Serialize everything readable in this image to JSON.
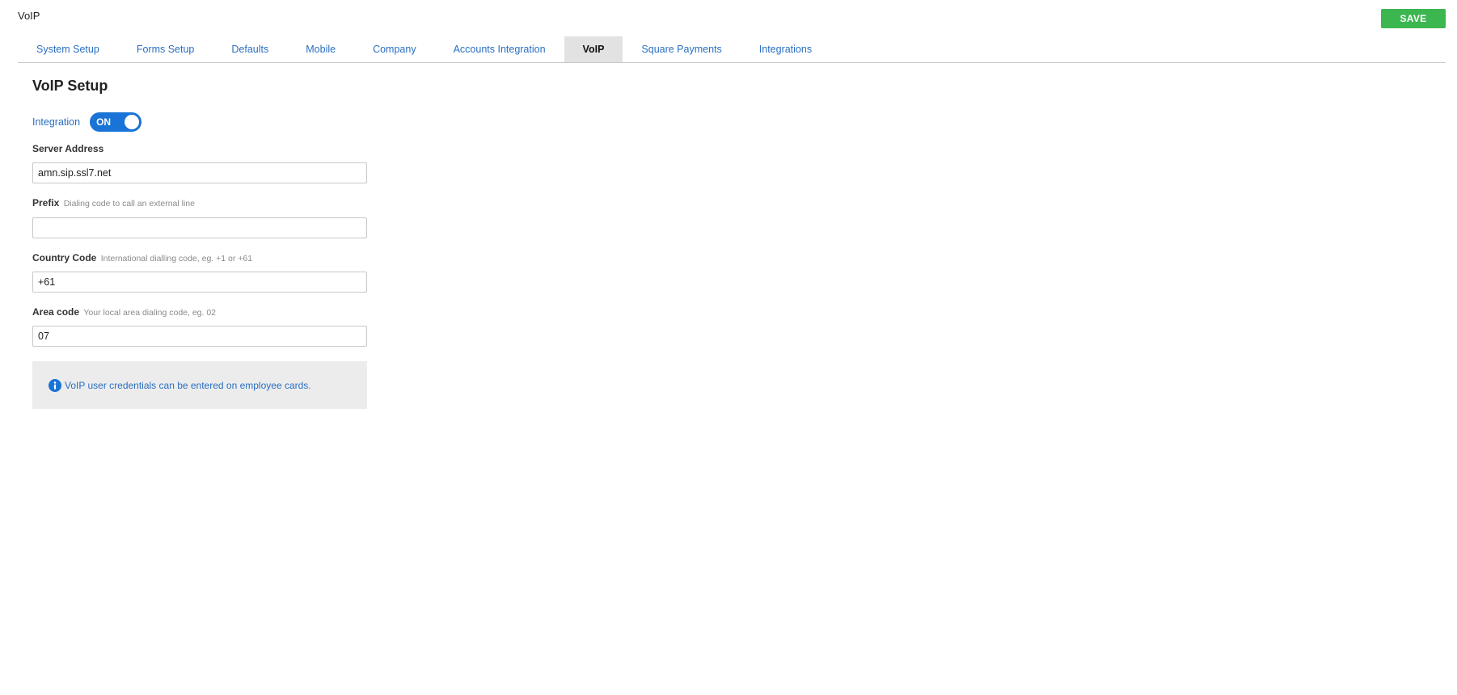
{
  "page": {
    "title": "VoIP",
    "save_label": "SAVE"
  },
  "tabs": [
    {
      "label": "System Setup"
    },
    {
      "label": "Forms Setup"
    },
    {
      "label": "Defaults"
    },
    {
      "label": "Mobile"
    },
    {
      "label": "Company"
    },
    {
      "label": "Accounts Integration"
    },
    {
      "label": "VoIP",
      "active": true
    },
    {
      "label": "Square Payments"
    },
    {
      "label": "Integrations"
    }
  ],
  "section": {
    "title": "VoIP Setup"
  },
  "integration": {
    "label": "Integration",
    "toggle_text": "ON",
    "enabled": true
  },
  "fields": {
    "server_address": {
      "label": "Server Address",
      "hint": "",
      "value": "amn.sip.ssl7.net"
    },
    "prefix": {
      "label": "Prefix",
      "hint": "Dialing code to call an external line",
      "value": ""
    },
    "country_code": {
      "label": "Country Code",
      "hint": "International dialling code, eg. +1 or +61",
      "value": "+61"
    },
    "area_code": {
      "label": "Area code",
      "hint": "Your local area dialing code, eg. 02",
      "value": "07"
    }
  },
  "info": {
    "icon": "info-icon",
    "text": "VoIP user credentials can be entered on employee cards."
  },
  "colors": {
    "accent": "#2a6fc2",
    "toggle_on": "#1a73d6",
    "save_button": "#3cb64f",
    "active_tab_bg": "#e2e2e2",
    "info_bg": "#ececec"
  }
}
